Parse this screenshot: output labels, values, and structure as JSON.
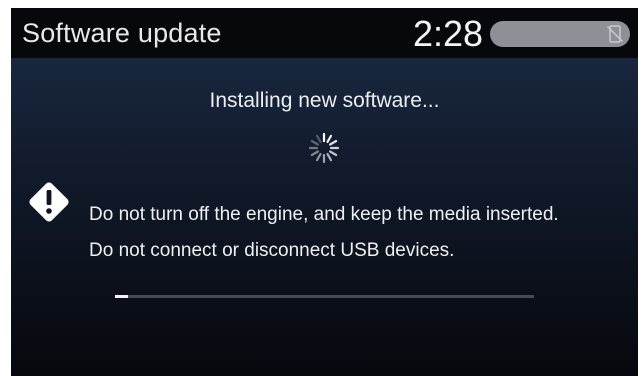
{
  "header": {
    "title": "Software update",
    "clock": "2:28",
    "status_icon": "no-phone-icon"
  },
  "main": {
    "installing_text": "Installing new software...",
    "spinner_icon": "spinner-icon",
    "warning_icon": "warning-icon",
    "warning_lines": [
      "Do not turn off the engine, and keep the media inserted.",
      "Do not connect or disconnect USB devices."
    ],
    "progress_fraction": 0.03
  },
  "colors": {
    "header_background": "#07080b",
    "screen_background_top": "#1b2c47",
    "screen_background_bottom": "#06080d",
    "text": "#eef0f3",
    "progress_fill": "#f2f3f5",
    "progress_track": "#454b55",
    "status_pill": "#8d9096"
  }
}
